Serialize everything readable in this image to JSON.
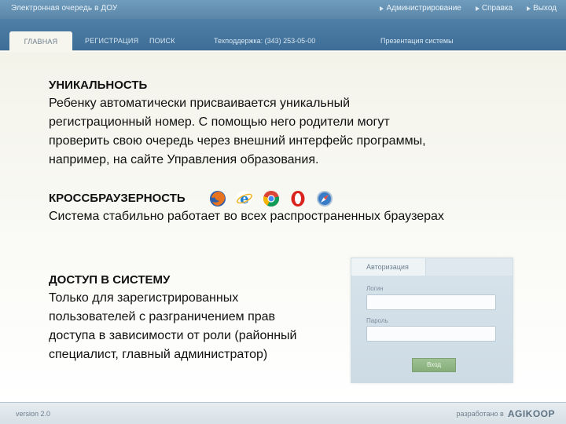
{
  "header": {
    "app_title": "Электронная очередь в ДОУ",
    "links": [
      "Администрирование",
      "Справка",
      "Выход"
    ]
  },
  "nav": {
    "tabs": [
      "ГЛАВНАЯ",
      "РЕГИСТРАЦИЯ",
      "ПОИСК"
    ],
    "support": "Техподдержка: (343) 253-05-00",
    "presentation": "Презентация системы"
  },
  "content": {
    "uniqueness": {
      "heading": "УНИКАЛЬНОСТЬ",
      "lines": [
        "Ребенку автоматически присваивается уникальный",
        "регистрационный номер. С помощью него родители могут",
        "проверить свою очередь через внешний интерфейс программы,",
        "например, на сайте Управления образования."
      ]
    },
    "crossbrowser": {
      "heading": "КРОССБРАУЗЕРНОСТЬ",
      "text": "Система стабильно работает во всех распространенных браузерах",
      "browser_icons": [
        "firefox-icon",
        "internet-explorer-icon",
        "chrome-icon",
        "opera-icon",
        "safari-icon"
      ]
    },
    "access": {
      "heading": "ДОСТУП В СИСТЕМУ",
      "lines": [
        "Только для зарегистрированных",
        "пользователей с разграничением прав",
        "доступа в зависимости от роли (районный",
        "специалист, главный администратор)"
      ]
    }
  },
  "auth": {
    "tab": "Авторизация",
    "login_label": "Логин",
    "password_label": "Пароль",
    "login_value": "",
    "password_value": "",
    "button": "Вход"
  },
  "footer": {
    "version": "version 2.0",
    "developer_prefix": "разработано в",
    "developer_logo": "AGIKOOP"
  },
  "colors": {
    "topbar": "#6f9cbd",
    "navbar": "#4f7fa6",
    "button": "#9ec293"
  }
}
